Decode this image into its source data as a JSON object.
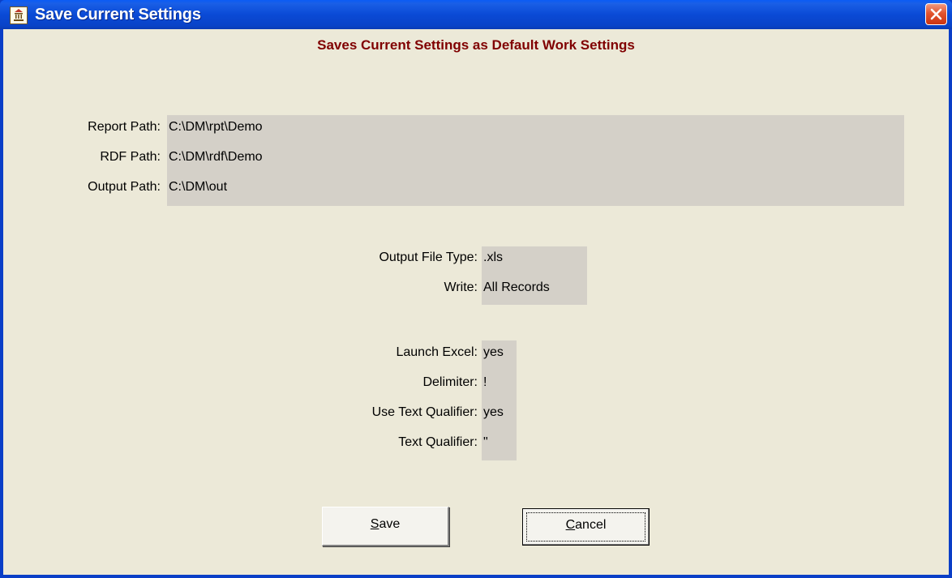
{
  "window": {
    "title": "Save Current Settings",
    "app_icon": "bank-icon",
    "close_icon": "close-icon"
  },
  "heading": "Saves Current Settings as Default Work Settings",
  "paths": [
    {
      "label": "Report Path:",
      "value": "C:\\DM\\rpt\\Demo"
    },
    {
      "label": "RDF Path:",
      "value": "C:\\DM\\rdf\\Demo"
    },
    {
      "label": "Output Path:",
      "value": "C:\\DM\\out"
    }
  ],
  "output": [
    {
      "label": "Output File Type:",
      "value": ".xls"
    },
    {
      "label": "Write:",
      "value": "All Records"
    }
  ],
  "options": [
    {
      "label": "Launch Excel:",
      "value": "yes"
    },
    {
      "label": "Delimiter:",
      "value": "!"
    },
    {
      "label": "Use Text Qualifier:",
      "value": "yes"
    },
    {
      "label": "Text Qualifier:",
      "value": "\""
    }
  ],
  "buttons": {
    "save": {
      "mnemonic": "S",
      "rest": "ave"
    },
    "cancel": {
      "mnemonic": "C",
      "rest": "ancel"
    }
  },
  "colors": {
    "heading": "#800000",
    "titlebar": "#0a4ad6",
    "panel": "#d4d0c8",
    "background": "#ece9d8"
  }
}
